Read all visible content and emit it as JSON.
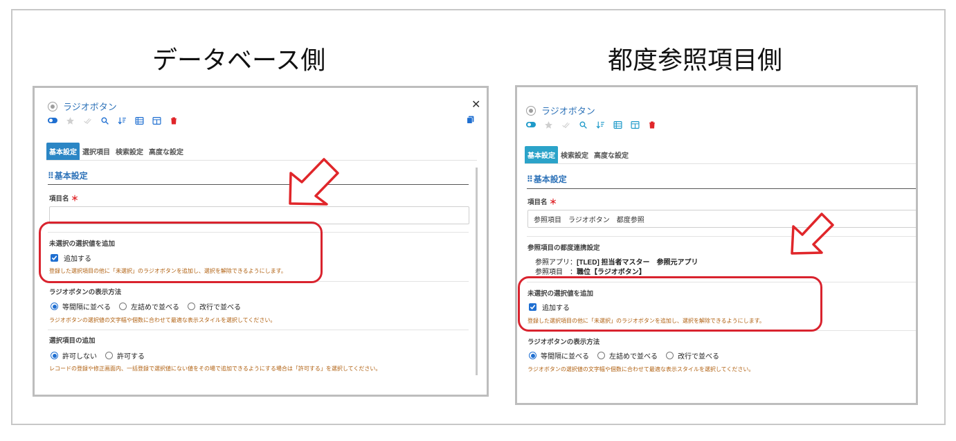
{
  "headings": {
    "left": "データベース側",
    "right": "都度参照項目側"
  },
  "colors": {
    "accent": "#2d72b8",
    "highlight": "#d9232e",
    "help": "#b06010",
    "tab_active_left": "#2b86c5",
    "tab_active_right": "#2ba3c9"
  },
  "left_panel": {
    "title": "ラジオボタン",
    "toolbar_icons": [
      "toggle-icon",
      "star-icon",
      "check-icon",
      "search-icon",
      "sort-icon",
      "list-icon",
      "columns-icon",
      "trash-icon"
    ],
    "close_label": "✕",
    "tabs": [
      "基本設定",
      "選択項目",
      "検索設定",
      "高度な設定"
    ],
    "section_title": "基本設定",
    "item_name_label": "項目名",
    "required_mark": "＊",
    "item_name_value": "",
    "unselected_label": "未選択の選択値を追加",
    "add_checkbox_label": "追加する",
    "unselected_help": "登録した選択項目の他に「未選択」のラジオボタンを追加し、選択を解除できるようにします。",
    "display_label": "ラジオボタンの表示方法",
    "display_options": [
      "等間隔に並べる",
      "左詰めで並べる",
      "改行で並べる"
    ],
    "display_help": "ラジオボタンの選択値の文字幅や個数に合わせて最適な表示スタイルを選択してください。",
    "add_item_label": "選択項目の追加",
    "add_item_options": [
      "許可しない",
      "許可する"
    ],
    "add_item_help": "レコードの登録や修正画面内、一括登録で選択値にない値をその場で追加できるようにする場合は「許可する」を選択してください。"
  },
  "right_panel": {
    "title": "ラジオボタン",
    "tabs": [
      "基本設定",
      "検索設定",
      "高度な設定"
    ],
    "section_title": "基本設定",
    "item_name_label": "項目名",
    "required_mark": "＊",
    "item_name_value": "参照項目　ラジオボタン　都度参照",
    "ref_label": "参照項目の都度連携設定",
    "ref_app_prefix": "参照アプリ：",
    "ref_app_value": "[TLED] 担当者マスター　参照元アプリ",
    "ref_item_prefix": "参照項目　：",
    "ref_item_value": "職位【ラジオボタン】",
    "unselected_label": "未選択の選択値を追加",
    "add_checkbox_label": "追加する",
    "unselected_help": "登録した選択項目の他に「未選択」のラジオボタンを追加し、選択を解除できるようにします。",
    "display_label": "ラジオボタンの表示方法",
    "display_options": [
      "等間隔に並べる",
      "左詰めで並べる",
      "改行で並べる"
    ],
    "display_help": "ラジオボタンの選択値の文字幅や個数に合わせて最適な表示スタイルを選択してください。"
  }
}
